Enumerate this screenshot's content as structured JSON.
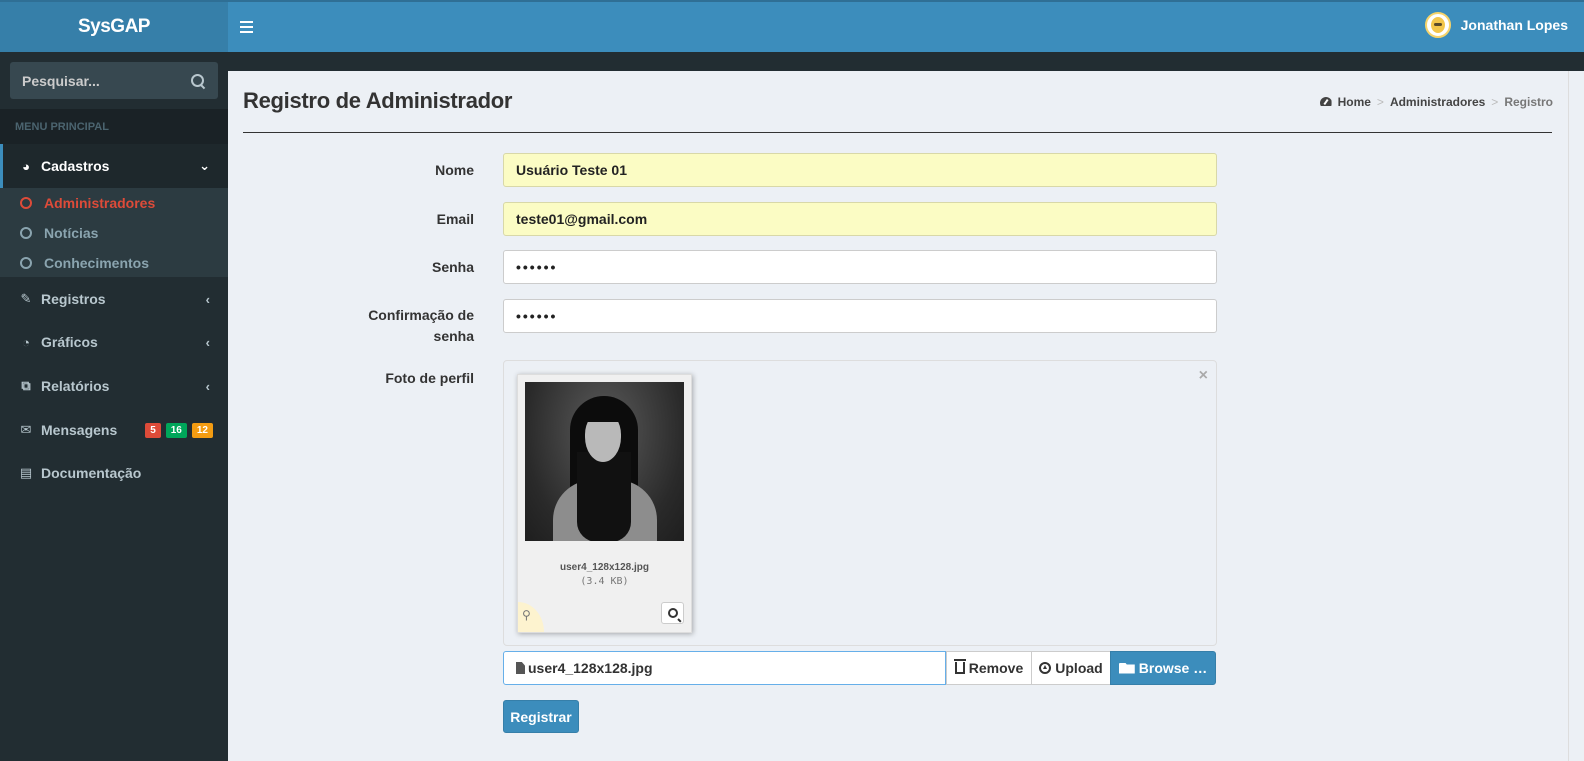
{
  "app": {
    "logo": "SysGAP"
  },
  "header": {
    "user_name": "Jonathan Lopes"
  },
  "sidebar": {
    "search_placeholder": "Pesquisar...",
    "menu_header": "MENU PRINCIPAL",
    "items": [
      {
        "label": "Cadastros",
        "icon": "dashboard-icon"
      },
      {
        "label": "Registros",
        "icon": "edit-icon"
      },
      {
        "label": "Gráficos",
        "icon": "pie-chart-icon"
      },
      {
        "label": "Relatórios",
        "icon": "copy-icon"
      },
      {
        "label": "Mensagens",
        "icon": "envelope-icon"
      },
      {
        "label": "Documentação",
        "icon": "book-icon"
      }
    ],
    "submenu": [
      {
        "label": "Administradores"
      },
      {
        "label": "Notícias"
      },
      {
        "label": "Conhecimentos"
      }
    ],
    "badges": [
      {
        "value": "5",
        "color": "#dd4b39"
      },
      {
        "value": "16",
        "color": "#00a65a"
      },
      {
        "value": "12",
        "color": "#f39c12"
      }
    ]
  },
  "page": {
    "title": "Registro de Administrador",
    "breadcrumb": [
      "Home",
      "Administradores",
      "Registro"
    ]
  },
  "form": {
    "nome_label": "Nome",
    "nome_value": "Usuário Teste 01",
    "email_label": "Email",
    "email_value": "teste01@gmail.com",
    "senha_label": "Senha",
    "senha_value": "••••••",
    "confirm_label_line1": "Confirmação de",
    "confirm_label_line2": "senha",
    "confirm_value": "••••••",
    "foto_label": "Foto de perfil",
    "close_glyph": "×",
    "file_name": "user4_128x128.jpg",
    "file_size": "(3.4 KB)",
    "caption": "user4_128x128.jpg",
    "remove_label": "Remove",
    "upload_label": "Upload",
    "browse_label": "Browse …",
    "submit_label": "Registrar"
  },
  "colors": {
    "header": "#3c8dbc",
    "logo_bg": "#367fa9",
    "sidebar": "#222d32",
    "active_sub": "#dd4b39",
    "filled_input": "#fbfcc4"
  }
}
